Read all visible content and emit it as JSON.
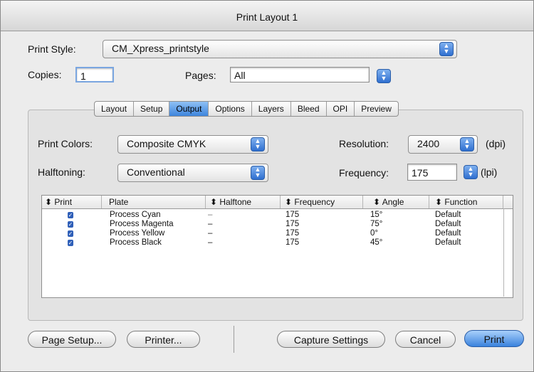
{
  "window": {
    "title": "Print Layout 1"
  },
  "print_style": {
    "label": "Print Style:",
    "value": "CM_Xpress_printstyle"
  },
  "copies": {
    "label": "Copies:",
    "value": "1"
  },
  "pages": {
    "label": "Pages:",
    "value": "All"
  },
  "tabs": [
    {
      "label": "Layout",
      "active": false
    },
    {
      "label": "Setup",
      "active": false
    },
    {
      "label": "Output",
      "active": true
    },
    {
      "label": "Options",
      "active": false
    },
    {
      "label": "Layers",
      "active": false
    },
    {
      "label": "Bleed",
      "active": false
    },
    {
      "label": "OPI",
      "active": false
    },
    {
      "label": "Preview",
      "active": false
    }
  ],
  "print_colors": {
    "label": "Print Colors:",
    "value": "Composite CMYK"
  },
  "halftoning": {
    "label": "Halftoning:",
    "value": "Conventional"
  },
  "resolution": {
    "label": "Resolution:",
    "value": "2400",
    "unit": "(dpi)"
  },
  "frequency": {
    "label": "Frequency:",
    "value": "175",
    "unit": "(lpi)"
  },
  "table": {
    "columns": [
      "Print",
      "Plate",
      "Halftone",
      "Frequency",
      "Angle",
      "Function"
    ],
    "rows": [
      {
        "print": true,
        "plate": "Process Cyan",
        "halftone": "–",
        "frequency": "175",
        "angle": "15°",
        "function": "Default"
      },
      {
        "print": true,
        "plate": "Process Magenta",
        "halftone": "–",
        "frequency": "175",
        "angle": "75°",
        "function": "Default"
      },
      {
        "print": true,
        "plate": "Process Yellow",
        "halftone": "–",
        "frequency": "175",
        "angle": "0°",
        "function": "Default"
      },
      {
        "print": true,
        "plate": "Process Black",
        "halftone": "–",
        "frequency": "175",
        "angle": "45°",
        "function": "Default"
      }
    ]
  },
  "buttons": {
    "page_setup": "Page Setup...",
    "printer": "Printer...",
    "capture_settings": "Capture Settings",
    "cancel": "Cancel",
    "print": "Print"
  }
}
